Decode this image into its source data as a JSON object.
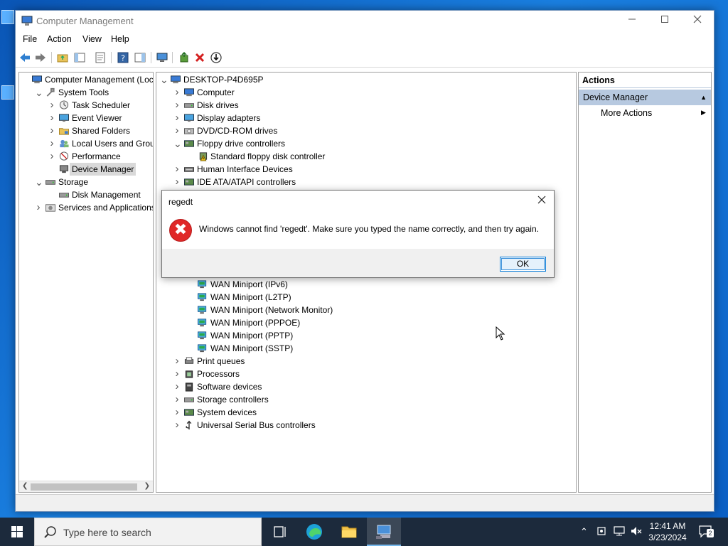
{
  "window": {
    "title": "Computer Management"
  },
  "menu": [
    "File",
    "Action",
    "View",
    "Help"
  ],
  "left_tree": [
    {
      "label": "Computer Management (Local",
      "indent": 0,
      "chevron": ""
    },
    {
      "label": "System Tools",
      "indent": 1,
      "chevron": "open"
    },
    {
      "label": "Task Scheduler",
      "indent": 2,
      "chevron": "closed"
    },
    {
      "label": "Event Viewer",
      "indent": 2,
      "chevron": "closed"
    },
    {
      "label": "Shared Folders",
      "indent": 2,
      "chevron": "closed"
    },
    {
      "label": "Local Users and Groups",
      "indent": 2,
      "chevron": "closed"
    },
    {
      "label": "Performance",
      "indent": 2,
      "chevron": "closed"
    },
    {
      "label": "Device Manager",
      "indent": 2,
      "chevron": "",
      "selected": true
    },
    {
      "label": "Storage",
      "indent": 1,
      "chevron": "open"
    },
    {
      "label": "Disk Management",
      "indent": 2,
      "chevron": ""
    },
    {
      "label": "Services and Applications",
      "indent": 1,
      "chevron": "closed"
    }
  ],
  "device_tree_top": [
    {
      "label": "DESKTOP-P4D695P",
      "indent": 0,
      "chevron": "open"
    },
    {
      "label": "Computer",
      "indent": 1,
      "chevron": "closed"
    },
    {
      "label": "Disk drives",
      "indent": 1,
      "chevron": "closed"
    },
    {
      "label": "Display adapters",
      "indent": 1,
      "chevron": "closed"
    },
    {
      "label": "DVD/CD-ROM drives",
      "indent": 1,
      "chevron": "closed"
    },
    {
      "label": "Floppy drive controllers",
      "indent": 1,
      "chevron": "open"
    },
    {
      "label": "Standard floppy disk controller",
      "indent": 2,
      "chevron": "",
      "warn": true
    },
    {
      "label": "Human Interface Devices",
      "indent": 1,
      "chevron": "closed"
    },
    {
      "label": "IDE ATA/ATAPI controllers",
      "indent": 1,
      "chevron": "closed"
    }
  ],
  "device_tree_bottom": [
    {
      "label": "WAN Miniport (IPv6)",
      "indent": 2,
      "chevron": ""
    },
    {
      "label": "WAN Miniport (L2TP)",
      "indent": 2,
      "chevron": ""
    },
    {
      "label": "WAN Miniport (Network Monitor)",
      "indent": 2,
      "chevron": ""
    },
    {
      "label": "WAN Miniport (PPPOE)",
      "indent": 2,
      "chevron": ""
    },
    {
      "label": "WAN Miniport (PPTP)",
      "indent": 2,
      "chevron": ""
    },
    {
      "label": "WAN Miniport (SSTP)",
      "indent": 2,
      "chevron": ""
    },
    {
      "label": "Print queues",
      "indent": 1,
      "chevron": "closed"
    },
    {
      "label": "Processors",
      "indent": 1,
      "chevron": "closed"
    },
    {
      "label": "Software devices",
      "indent": 1,
      "chevron": "closed"
    },
    {
      "label": "Storage controllers",
      "indent": 1,
      "chevron": "closed"
    },
    {
      "label": "System devices",
      "indent": 1,
      "chevron": "closed"
    },
    {
      "label": "Universal Serial Bus controllers",
      "indent": 1,
      "chevron": "closed"
    }
  ],
  "actions": {
    "header": "Actions",
    "section": "Device Manager",
    "more": "More Actions"
  },
  "dialog": {
    "title": "regedt",
    "message": "Windows cannot find 'regedt'. Make sure you typed the name correctly, and then try again.",
    "ok": "OK"
  },
  "taskbar": {
    "search_placeholder": "Type here to search",
    "time": "12:41 AM",
    "date": "3/23/2024",
    "notification_count": "2"
  },
  "colors": {
    "selection_gray": "#d9d9d9",
    "actions_section_blue": "#b7c9e0",
    "error_red": "#e02828",
    "taskbar_bg": "#1c2a3c"
  }
}
